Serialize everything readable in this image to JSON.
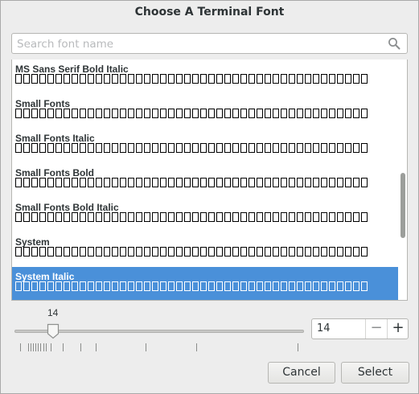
{
  "dialog": {
    "title": "Choose A Terminal Font"
  },
  "search": {
    "placeholder": "Search font name",
    "value": "",
    "icon": "search-icon"
  },
  "font_list": {
    "items": [
      {
        "name": "MS Sans Serif Bold Italic",
        "selected": false
      },
      {
        "name": "Small Fonts",
        "selected": false
      },
      {
        "name": "Small Fonts Italic",
        "selected": false
      },
      {
        "name": "Small Fonts Bold",
        "selected": false
      },
      {
        "name": "Small Fonts Bold Italic",
        "selected": false
      },
      {
        "name": "System",
        "selected": false
      },
      {
        "name": "System Italic",
        "selected": true
      }
    ],
    "selected_bg": "#4a90d9"
  },
  "size": {
    "slider_value_label": "14",
    "slider_value": 14,
    "spin_value": "14",
    "minus_label": "−",
    "plus_label": "+"
  },
  "buttons": {
    "cancel_label": "Cancel",
    "select_label": "Select"
  }
}
